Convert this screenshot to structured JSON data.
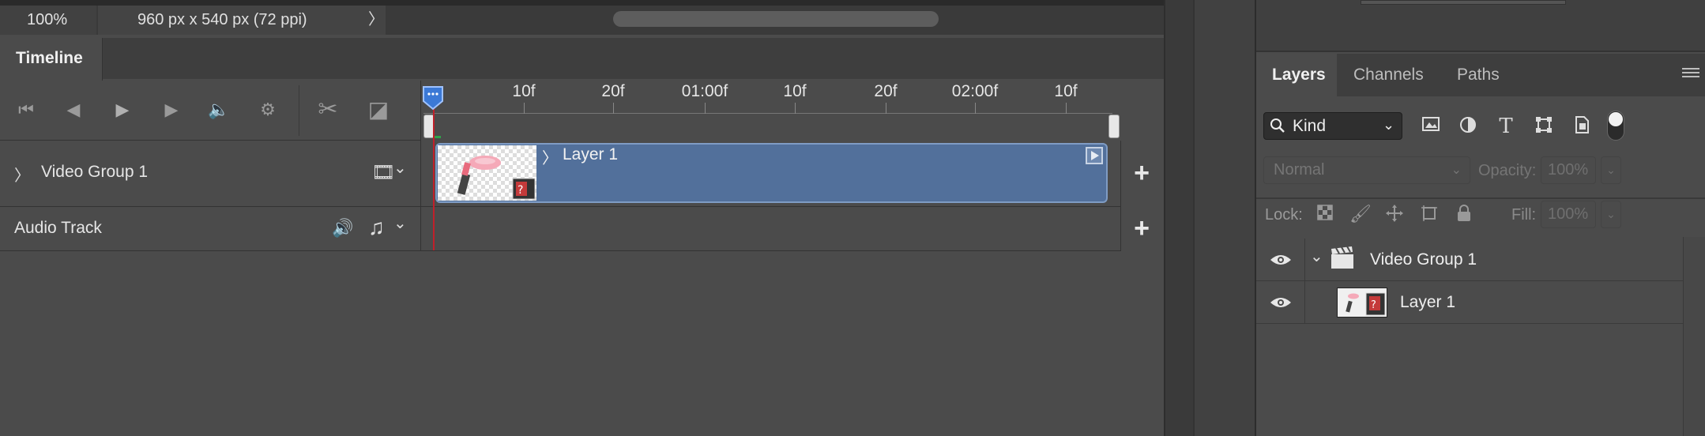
{
  "status": {
    "zoom": "100%",
    "doc_info": "960 px x 540 px (72 ppi)",
    "arrow": "〉"
  },
  "timeline": {
    "tab_label": "Timeline",
    "controls": {
      "go_first": "⏮",
      "prev_frame": "◀",
      "play": "▶",
      "next_frame": "▶",
      "audio": "🔈",
      "settings": "⚙",
      "split": "✂",
      "transition": "◪"
    },
    "ruler_ticks": [
      "10f",
      "20f",
      "01:00f",
      "10f",
      "20f",
      "02:00f",
      "10f"
    ],
    "tracks": [
      {
        "label": "Video Group 1",
        "chevron": "〉",
        "media_icon": "🎞"
      },
      {
        "label": "Audio Track",
        "speaker_icon": "🔊",
        "media_icon": "♫"
      }
    ],
    "clip": {
      "label": "Layer 1",
      "chevron": "〉"
    },
    "add": "+",
    "dropdown": "⌄"
  },
  "layers": {
    "tabs": [
      "Layers",
      "Channels",
      "Paths"
    ],
    "filter_kind": "Kind",
    "blend_mode": "Normal",
    "opacity_label": "Opacity:",
    "opacity_value": "100%",
    "lock_label": "Lock:",
    "fill_label": "Fill:",
    "fill_value": "100%",
    "rows": [
      {
        "name": "Video Group 1",
        "expander": "⌄"
      },
      {
        "name": "Layer 1"
      }
    ]
  },
  "colors": {
    "clip_fill": "#52709b",
    "playhead": "#c0202a",
    "panel_bg": "#4b4b4b"
  }
}
